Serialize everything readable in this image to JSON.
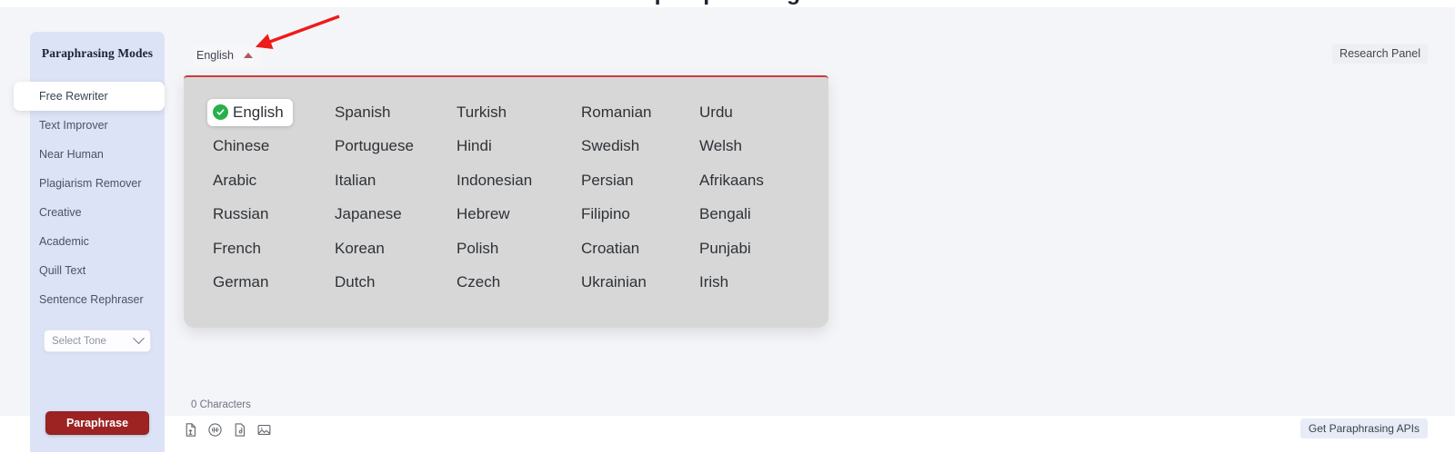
{
  "page": {
    "cutoff_heading": "paraphrasing"
  },
  "sidebar": {
    "title": "Paraphrasing Modes",
    "modes": [
      {
        "label": "Free Rewriter",
        "active": true
      },
      {
        "label": "Text Improver",
        "active": false
      },
      {
        "label": "Near Human",
        "active": false
      },
      {
        "label": "Plagiarism Remover",
        "active": false
      },
      {
        "label": "Creative",
        "active": false
      },
      {
        "label": "Academic",
        "active": false
      },
      {
        "label": "Quill Text",
        "active": false
      },
      {
        "label": "Sentence Rephraser",
        "active": false
      }
    ],
    "tone_select": {
      "value": "Select Tone",
      "icon": "chevron-down-icon"
    },
    "paraphrase_button": "Paraphrase"
  },
  "topbar": {
    "language_trigger": "English",
    "caret_icon": "caret-up-icon",
    "research_panel": "Research Panel"
  },
  "language_panel": {
    "selected": "English",
    "check_icon": "check-circle-icon",
    "columns": 5,
    "languages": [
      "English",
      "Spanish",
      "Turkish",
      "Romanian",
      "Urdu",
      "Chinese",
      "Portuguese",
      "Hindi",
      "Swedish",
      "Welsh",
      "Arabic",
      "Italian",
      "Indonesian",
      "Persian",
      "Afrikaans",
      "Russian",
      "Japanese",
      "Hebrew",
      "Filipino",
      "Bengali",
      "French",
      "Korean",
      "Polish",
      "Croatian",
      "Punjabi",
      "German",
      "Dutch",
      "Czech",
      "Ukrainian",
      "Irish"
    ]
  },
  "editor_footer": {
    "character_count": "0 Characters",
    "tools": [
      {
        "name": "file-upload-icon"
      },
      {
        "name": "audio-waveform-icon"
      },
      {
        "name": "music-file-icon"
      },
      {
        "name": "image-icon"
      }
    ],
    "api_button": "Get Paraphrasing APIs"
  },
  "colors": {
    "accent_red": "#9d2323",
    "panel_border_red": "#cf3a3a",
    "sidebar_bg": "#dce3f6",
    "panel_bg": "#d7d7d7",
    "check_green": "#2ab04a",
    "annotation_red": "#ee1b1b",
    "app_bg": "#f4f5f8"
  }
}
